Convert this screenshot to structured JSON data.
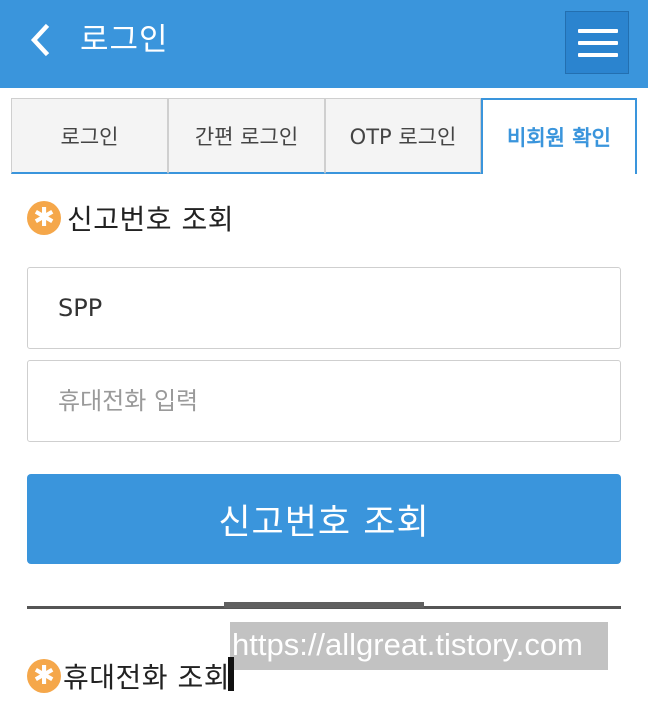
{
  "header": {
    "title": "로그인",
    "back_icon": "chevron-left-icon",
    "menu_icon": "hamburger-menu-icon",
    "background": "#3a95dc"
  },
  "tabs": [
    {
      "label": "로그인",
      "active": false
    },
    {
      "label": "간편 로그인",
      "active": false
    },
    {
      "label": "OTP 로그인",
      "active": false
    },
    {
      "label": "비회원 확인",
      "active": true
    }
  ],
  "report_lookup": {
    "title": "신고번호 조회",
    "marker": "✱",
    "report_number_value": "SPP",
    "phone_placeholder": "휴대전화 입력",
    "submit_label": "신고번호 조회"
  },
  "phone_lookup": {
    "title": "휴대전화 조회",
    "marker": "✱"
  },
  "watermark": "https://allgreat.tistory.com",
  "colors": {
    "accent": "#3a95dc",
    "marker": "#f5a74a"
  }
}
